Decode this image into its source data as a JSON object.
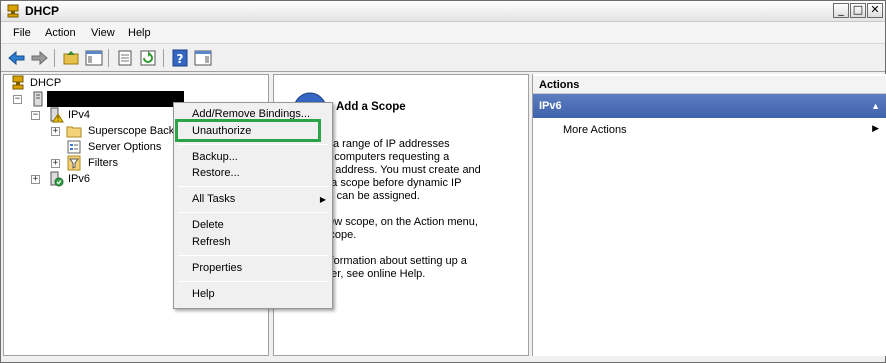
{
  "window": {
    "title": "DHCP",
    "controls": [
      "_",
      "□",
      "✕"
    ]
  },
  "menubar": {
    "items": [
      "File",
      "Action",
      "View",
      "Help"
    ]
  },
  "tree": {
    "root": "DHCP",
    "server_label_redacted": "",
    "items": [
      {
        "label": "IPv4"
      },
      {
        "label": "Superscope Backu"
      },
      {
        "label": "Server Options"
      },
      {
        "label": "Filters"
      },
      {
        "label": "IPv6"
      }
    ]
  },
  "context_menu": {
    "items": [
      {
        "label": "Add/Remove Bindings..."
      },
      {
        "label": "Unauthorize"
      },
      {
        "label": "Backup..."
      },
      {
        "label": "Restore..."
      },
      {
        "label": "All Tasks"
      },
      {
        "label": "Delete"
      },
      {
        "label": "Refresh"
      },
      {
        "label": "Properties"
      },
      {
        "label": "Help"
      }
    ]
  },
  "middle": {
    "title": "Add a Scope",
    "lines": [
      "is a range of IP addresses",
      "to computers requesting a",
      "IP address. You must create and",
      "e a scope before dynamic IP",
      "es can be assigned.",
      "new scope, on the Action menu,",
      "Scope.",
      "information about setting up a",
      "rver, see online Help."
    ]
  },
  "actions": {
    "header": "Actions",
    "group": "IPv6",
    "items": [
      {
        "label": "More Actions"
      }
    ]
  },
  "colors": {
    "highlight_border": "#2aa34a",
    "actions_group_bg": "#4a6bb5"
  }
}
